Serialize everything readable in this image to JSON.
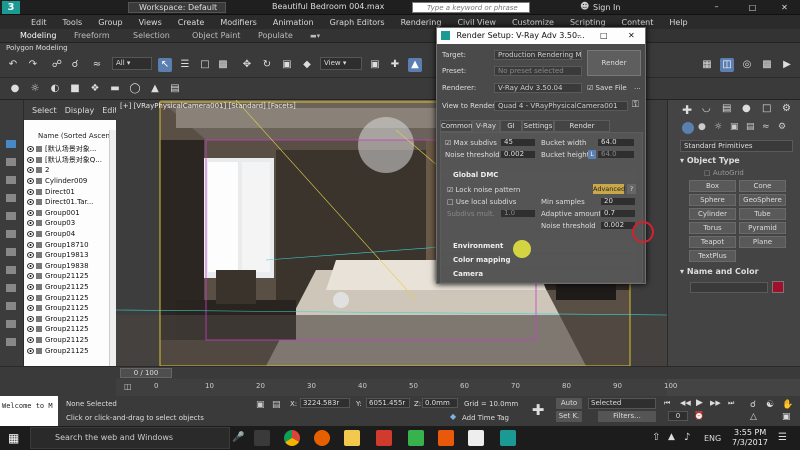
{
  "titlebar": {
    "workspace_label": "Workspace: Default",
    "file_title": "Beautiful Bedroom 004.max",
    "search_placeholder": "Type a keyword or phrase",
    "sign_in": "Sign In"
  },
  "menu": [
    "Edit",
    "Tools",
    "Group",
    "Views",
    "Create",
    "Modifiers",
    "Animation",
    "Graph Editors",
    "Rendering",
    "Civil View",
    "Customize",
    "Scripting",
    "Content",
    "Help"
  ],
  "ribbon_tabs": [
    "Modeling",
    "Freeform",
    "Selection",
    "Object Paint",
    "Populate"
  ],
  "poly_label": "Polygon Modeling",
  "toolbar": {
    "filter": "All",
    "view": "View"
  },
  "explorer": {
    "tabs": [
      "Select",
      "Display",
      "Edit"
    ],
    "header": "Name (Sorted Ascending)",
    "items": [
      "[默认场景对象...",
      "[默认场景对象Q...",
      "2",
      "Cylinder009",
      "Direct01",
      "Direct01.Tar...",
      "Group001",
      "Group03",
      "Group04",
      "Group18710",
      "Group19813",
      "Group19838",
      "Group21125",
      "Group21125",
      "Group21125",
      "Group21125",
      "Group21125",
      "Group21125",
      "Group21125",
      "Group21125"
    ]
  },
  "viewport": {
    "label": "[+] [VRayPhysicalCamera001] [Standard] [Facets]"
  },
  "right_panel": {
    "category": "Standard Primitives",
    "object_type_title": "Object Type",
    "autogrid": "AutoGrid",
    "buttons": [
      "Box",
      "Cone",
      "Sphere",
      "GeoSphere",
      "Cylinder",
      "Tube",
      "Torus",
      "Pyramid",
      "Teapot",
      "Plane",
      "TextPlus"
    ],
    "name_color_title": "Name and Color",
    "color": "#a0102a"
  },
  "dialog": {
    "title": "Render Setup: V-Ray Adv 3.50...",
    "target_label": "Target:",
    "target_value": "Production Rendering Mode",
    "preset_label": "Preset:",
    "preset_value": "No preset selected",
    "renderer_label": "Renderer:",
    "renderer_value": "V-Ray Adv 3.50.04",
    "save_file": "Save File",
    "render_button": "Render",
    "view_label": "View to Render:",
    "view_value": "Quad 4 - VRayPhysicalCamera001",
    "tabs": [
      "Common",
      "V-Ray",
      "GI",
      "Settings",
      "Render Elements"
    ],
    "max_subdivs_label": "Max subdivs",
    "max_subdivs": "45",
    "noise_threshold_label": "Noise threshold",
    "noise_threshold": "0.002",
    "bucket_width_label": "Bucket width",
    "bucket_width": "64.0",
    "bucket_height_label": "Bucket height",
    "bucket_height": "64.0",
    "bucket_lock": "L",
    "gdmc_title": "Global DMC",
    "lock_noise": "Lock noise pattern",
    "advanced": "Advanced",
    "help": "?",
    "use_local": "Use local subdivs",
    "subdivs_mult_label": "Subdivs mult.",
    "subdivs_mult": "1.0",
    "min_samples_label": "Min samples",
    "min_samples": "20",
    "adaptive_label": "Adaptive amount",
    "adaptive": "0.7",
    "noise2_label": "Noise threshold",
    "noise2": "0.002",
    "env": "Environment",
    "colormap": "Color mapping",
    "camera": "Camera"
  },
  "timeline": {
    "frame": "0 / 100",
    "ticks": [
      "0",
      "10",
      "20",
      "30",
      "40",
      "50",
      "60",
      "70",
      "80",
      "90",
      "100"
    ]
  },
  "status": {
    "welcome": "Welcome to M",
    "selection": "None Selected",
    "hint": "Click or click-and-drag to select objects",
    "x_label": "X:",
    "x": "3224.583r",
    "y_label": "Y:",
    "y": "6051.455r",
    "z_label": "Z:",
    "z": "0.0mm",
    "grid": "Grid = 10.0mm",
    "add_time_tag": "Add Time Tag",
    "auto_key": "Auto Key",
    "set_key": "Set K.",
    "selected": "Selected",
    "filters": "Filters...",
    "frame_box": "0"
  },
  "taskbar": {
    "search": "Search the web and Windows",
    "lang": "ENG",
    "time": "3:55 PM",
    "date": "7/3/2017"
  }
}
